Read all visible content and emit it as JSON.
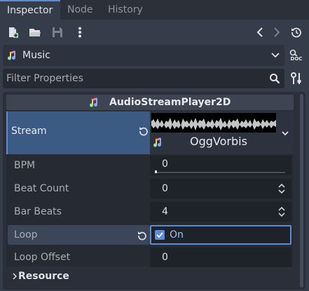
{
  "tabs": [
    {
      "label": "Inspector",
      "active": true
    },
    {
      "label": "Node",
      "active": false
    },
    {
      "label": "History",
      "active": false
    }
  ],
  "toolbar": {
    "icons": [
      "new-resource-icon",
      "open-folder-icon",
      "save-icon",
      "more-options-icon",
      "back-icon",
      "forward-icon",
      "history-icon"
    ]
  },
  "resource_selector": {
    "label": "Music",
    "icon": "audio-icon",
    "doc_label": "DOC"
  },
  "filter": {
    "placeholder": "Filter Properties"
  },
  "inspector": {
    "title": "AudioStreamPlayer2D",
    "stream": {
      "label": "Stream",
      "resource": "OggVorbis"
    },
    "properties": {
      "bpm": {
        "label": "BPM",
        "value": "0"
      },
      "beat_count": {
        "label": "Beat Count",
        "value": "0"
      },
      "bar_beats": {
        "label": "Bar Beats",
        "value": "4"
      },
      "loop": {
        "label": "Loop",
        "value": "On",
        "checked": true
      },
      "loop_offset": {
        "label": "Loop Offset",
        "value": "0"
      }
    },
    "resource_section": {
      "label": "Resource"
    }
  },
  "colors": {
    "accent": "#5c8bd8",
    "selected_row": "#3b5b85",
    "panel": "#2a2f39"
  }
}
